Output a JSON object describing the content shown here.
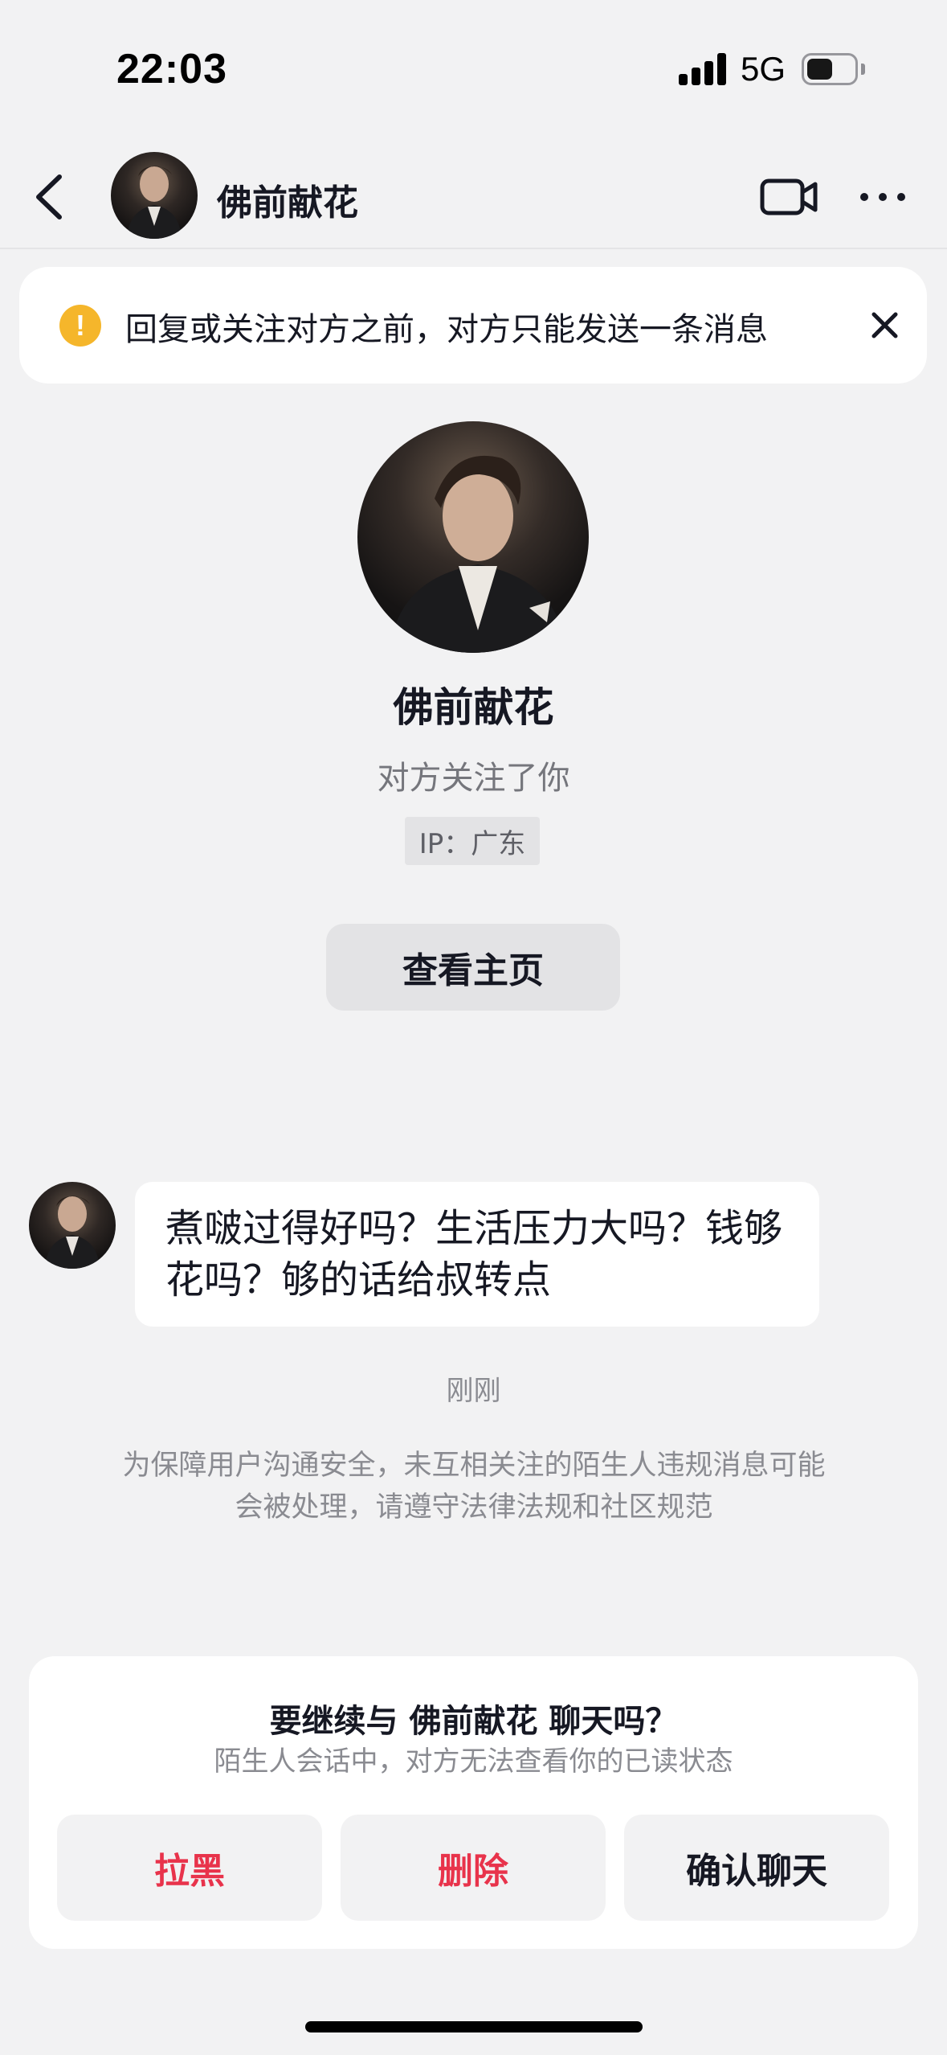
{
  "status_bar": {
    "time": "22:03",
    "network": "5G"
  },
  "header": {
    "name": "佛前献花"
  },
  "notice": {
    "text": "回复或关注对方之前，对方只能发送一条消息",
    "icon": "!"
  },
  "profile": {
    "name": "佛前献花",
    "relation": "对方关注了你",
    "ip": "IP：广东",
    "view_home_label": "查看主页"
  },
  "message": {
    "text": "煮啵过得好吗？生活压力大吗？钱够花吗？够的话给叔转点",
    "time": "刚刚"
  },
  "safety_note": "为保障用户沟通安全，未互相关注的陌生人违规消息可能会被处理，请遵守法律法规和社区规范",
  "sheet": {
    "title": "要继续与 佛前献花 聊天吗？",
    "subtitle": "陌生人会话中，对方无法查看你的已读状态",
    "block_label": "拉黑",
    "delete_label": "删除",
    "confirm_label": "确认聊天"
  },
  "colors": {
    "background": "#f2f2f3",
    "danger": "#e8334b",
    "warning": "#f5b62b",
    "text_primary": "#161823",
    "text_secondary": "#8a8b91"
  }
}
